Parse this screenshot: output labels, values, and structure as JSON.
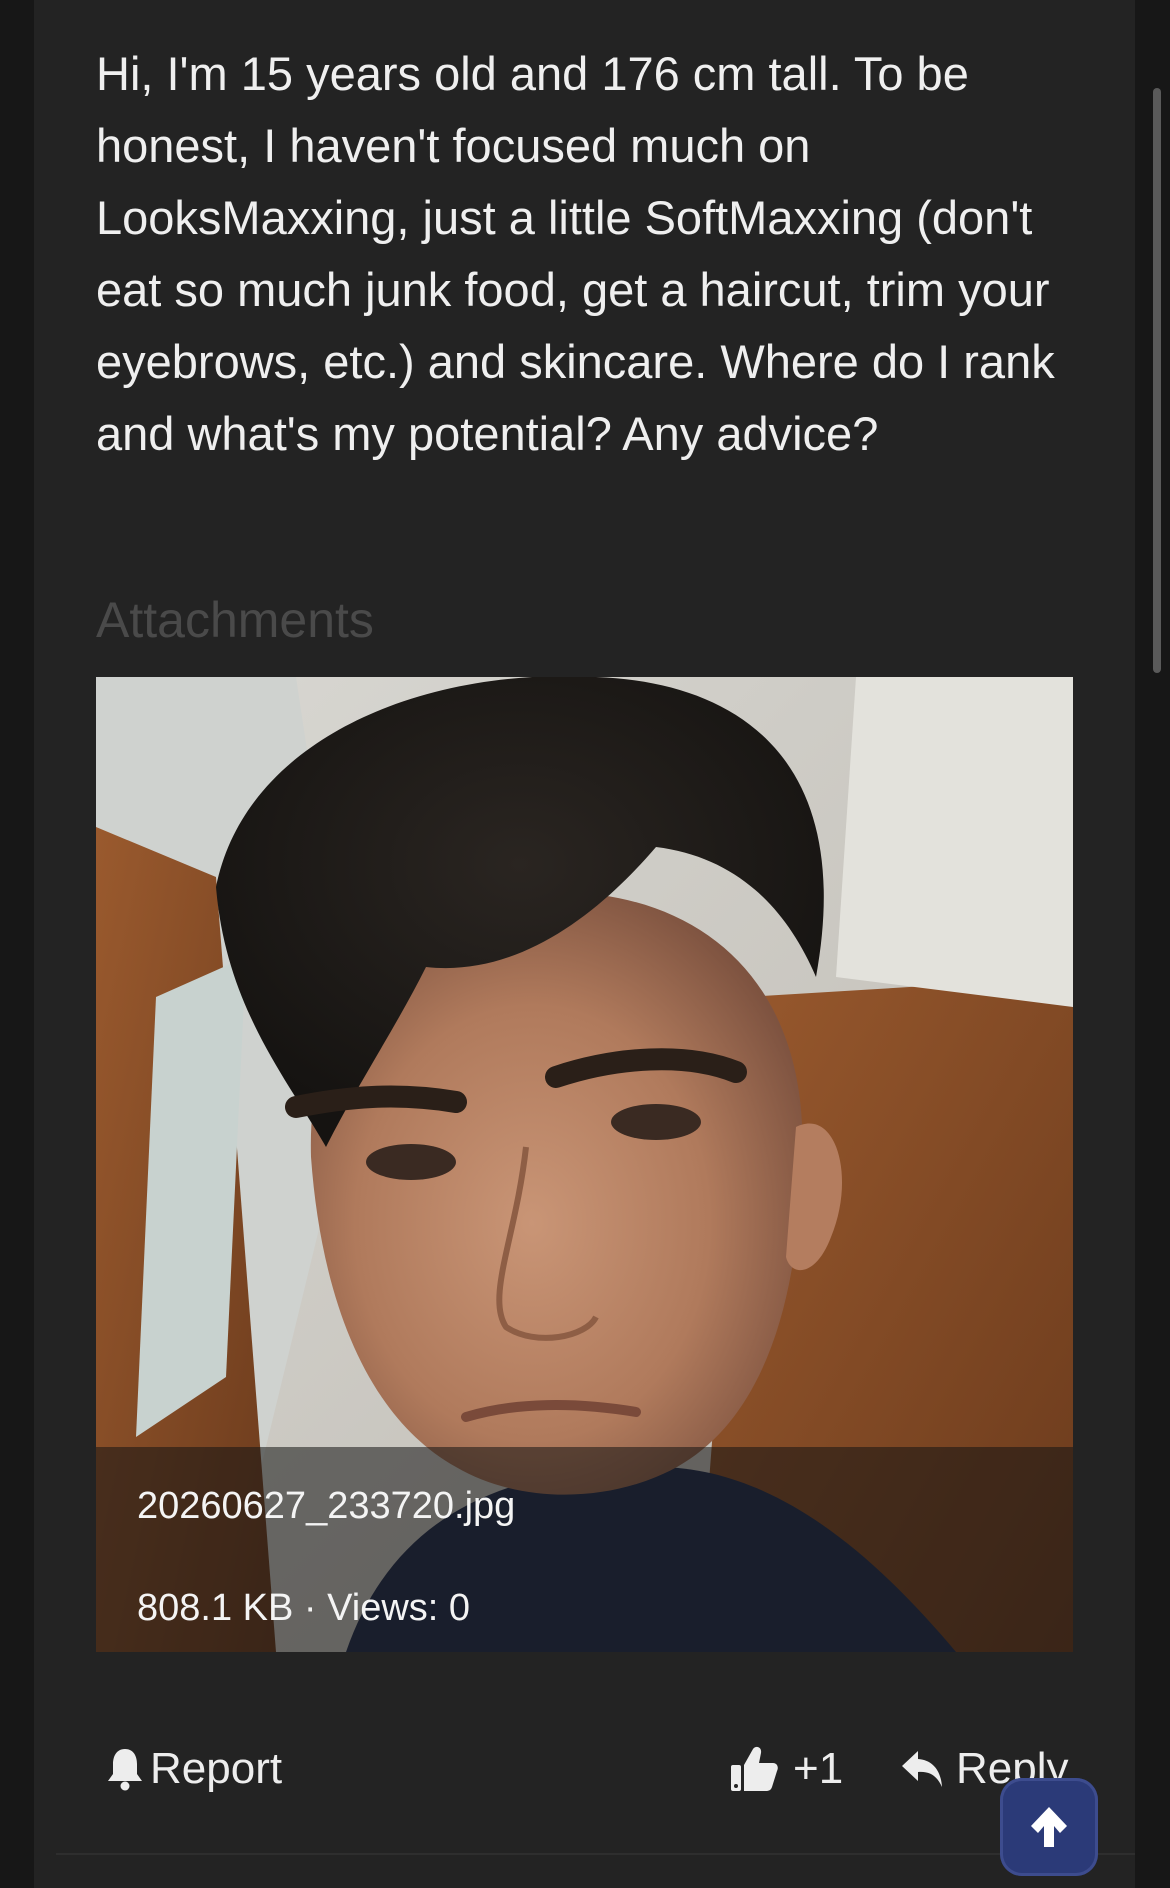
{
  "post": {
    "body": "Hi, I'm 15 years old and 176 cm tall. To be honest, I haven't focused much on LooksMaxxing, just a little SoftMaxxing (don't eat so much junk food, get a haircut, trim your eyebrows, etc.) and skincare. Where do I rank and what's my potential? Any advice?",
    "attachments_heading": "Attachments",
    "attachment": {
      "filename": "20260627_233720.jpg",
      "meta": "808.1 KB · Views: 0"
    }
  },
  "actions": {
    "report_label": "Report",
    "like_count": "+1",
    "reply_label": "Reply"
  },
  "colors": {
    "page_bg": "#171717",
    "post_bg": "#232323",
    "accent_button": "#2b3a78"
  },
  "icons": {
    "report": "bell-icon",
    "like": "thumbs-up-icon",
    "reply": "reply-arrow-icon",
    "scroll_top": "arrow-up-icon"
  }
}
